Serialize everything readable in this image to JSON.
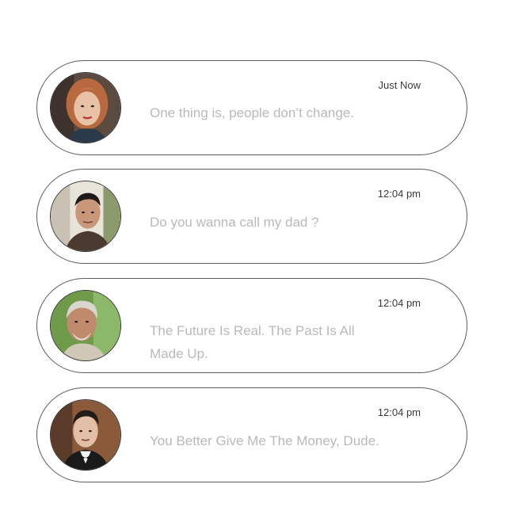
{
  "notifications": [
    {
      "avatar_icon": "avatar-red-haired-woman",
      "time": "Just Now",
      "message": "One thing is, people don’t change."
    },
    {
      "avatar_icon": "avatar-dark-haired-man",
      "time": "12:04 pm",
      "message": "Do you wanna call my dad ?"
    },
    {
      "avatar_icon": "avatar-older-gray-haired-man",
      "time": "12:04 pm",
      "message": "The Future Is Real. The Past Is All Made Up."
    },
    {
      "avatar_icon": "avatar-man-in-tuxedo",
      "time": "12:04 pm",
      "message": "You Better Give Me The Money, Dude."
    }
  ]
}
